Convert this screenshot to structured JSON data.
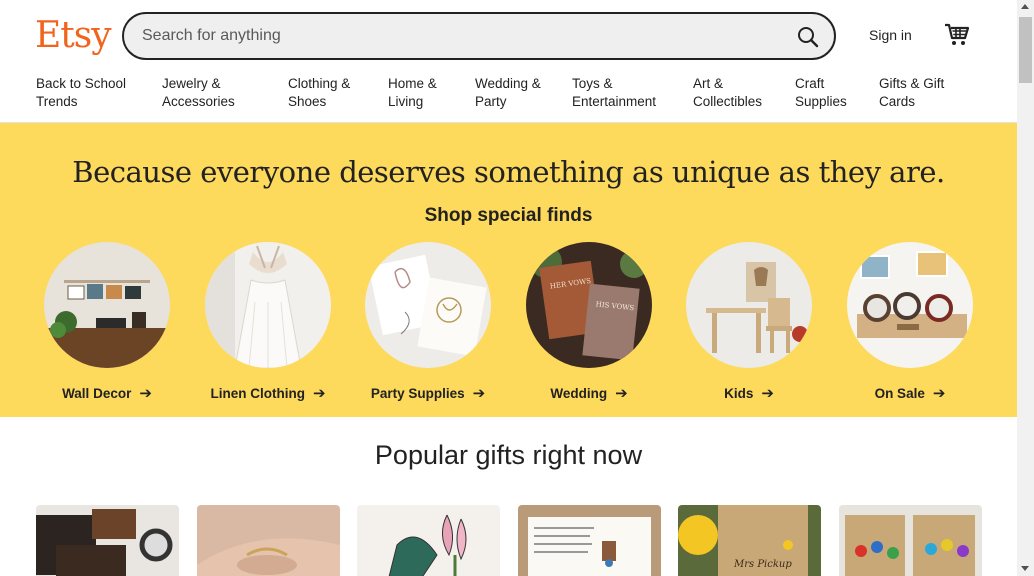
{
  "header": {
    "logo": "Etsy",
    "search_placeholder": "Search for anything",
    "sign_in": "Sign in",
    "icons": [
      "search-icon",
      "cart-icon"
    ]
  },
  "nav": {
    "items": [
      {
        "line1": "Back to School",
        "line2": "Trends"
      },
      {
        "line1": "Jewelry &",
        "line2": "Accessories"
      },
      {
        "line1": "Clothing &",
        "line2": "Shoes"
      },
      {
        "line1": "Home &",
        "line2": "Living"
      },
      {
        "line1": "Wedding &",
        "line2": "Party"
      },
      {
        "line1": "Toys &",
        "line2": "Entertainment"
      },
      {
        "line1": "Art &",
        "line2": "Collectibles"
      },
      {
        "line1": "Craft",
        "line2": "Supplies"
      },
      {
        "line1": "Gifts & Gift",
        "line2": "Cards"
      }
    ]
  },
  "hero": {
    "title": "Because everyone deserves something as unique as they are.",
    "subtitle": "Shop special finds",
    "categories": [
      {
        "label": "Wall Decor"
      },
      {
        "label": "Linen Clothing"
      },
      {
        "label": "Party Supplies"
      },
      {
        "label": "Wedding"
      },
      {
        "label": "Kids"
      },
      {
        "label": "On Sale"
      }
    ],
    "colors": {
      "background": "#FDD95C",
      "brand": "#F1641E"
    }
  },
  "popular": {
    "title": "Popular gifts right now"
  }
}
